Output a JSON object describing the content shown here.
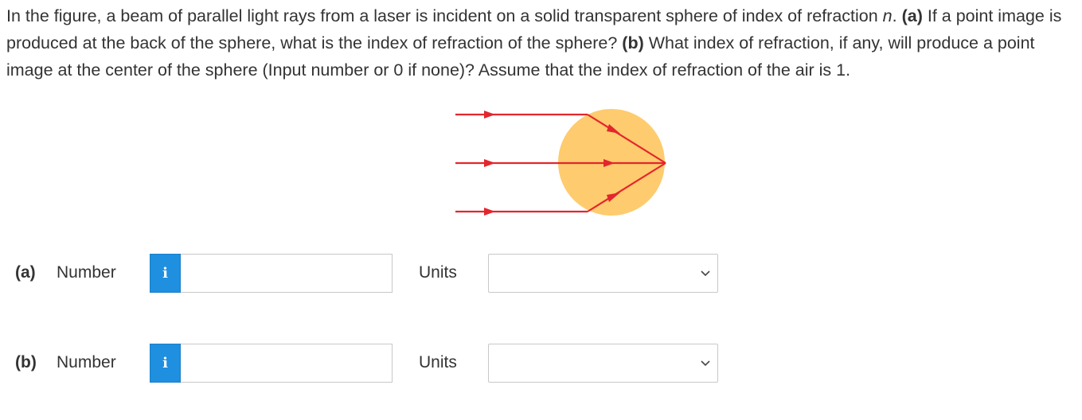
{
  "question": {
    "segments": [
      {
        "text": "In the figure, a beam of parallel light rays from a laser is incident on a solid transparent sphere of index of refraction ",
        "style": "normal"
      },
      {
        "text": "n",
        "style": "italic"
      },
      {
        "text": ". ",
        "style": "normal"
      },
      {
        "text": "(a)",
        "style": "bold"
      },
      {
        "text": " If a point image is produced at the back of the sphere, what is the index of refraction of the sphere? ",
        "style": "normal"
      },
      {
        "text": "(b)",
        "style": "bold"
      },
      {
        "text": " What index of refraction, if any, will produce a point image at the center of the sphere (Input number or 0 if none)? Assume that the index of refraction of the air is 1.",
        "style": "normal"
      }
    ]
  },
  "figure": {
    "colors": {
      "sphere": "#fecb6e",
      "ray": "#e3262d"
    }
  },
  "parts": [
    {
      "label": "(a)",
      "number_label": "Number",
      "info_icon": "info-icon",
      "number_value": "",
      "units_label": "Units",
      "units_value": "",
      "dropdown_icon": "chevron-down-icon"
    },
    {
      "label": "(b)",
      "number_label": "Number",
      "info_icon": "info-icon",
      "number_value": "",
      "units_label": "Units",
      "units_value": "",
      "dropdown_icon": "chevron-down-icon"
    }
  ],
  "colors": {
    "info_button": "#1f8fe0",
    "text": "#333333",
    "border": "#c8c8c8"
  }
}
